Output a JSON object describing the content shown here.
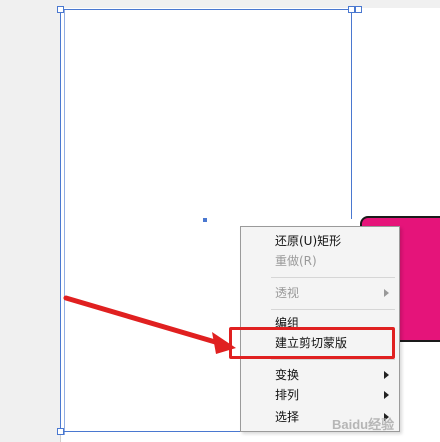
{
  "context_menu": {
    "items": [
      {
        "label": "还原(U)矩形",
        "enabled": true,
        "submenu": false
      },
      {
        "label": "重做(R)",
        "enabled": false,
        "submenu": false
      },
      {
        "label": "透视",
        "enabled": false,
        "submenu": true
      },
      {
        "label": "编组",
        "enabled": true,
        "submenu": false
      },
      {
        "label": "建立剪切蒙版",
        "enabled": true,
        "submenu": false,
        "highlighted": true
      },
      {
        "label": "变换",
        "enabled": true,
        "submenu": true
      },
      {
        "label": "排列",
        "enabled": true,
        "submenu": true
      },
      {
        "label": "选择",
        "enabled": true,
        "submenu": true
      }
    ]
  },
  "annotation": {
    "color": "#e02020",
    "target": "建立剪切蒙版"
  },
  "colors": {
    "selection": "#4a78d0",
    "shape_fill": "#e5147a",
    "shape_stroke": "#1a1a1a",
    "canvas": "#f0f0f0",
    "artboard": "#ffffff"
  },
  "watermark": {
    "text": "Baidu经验"
  }
}
